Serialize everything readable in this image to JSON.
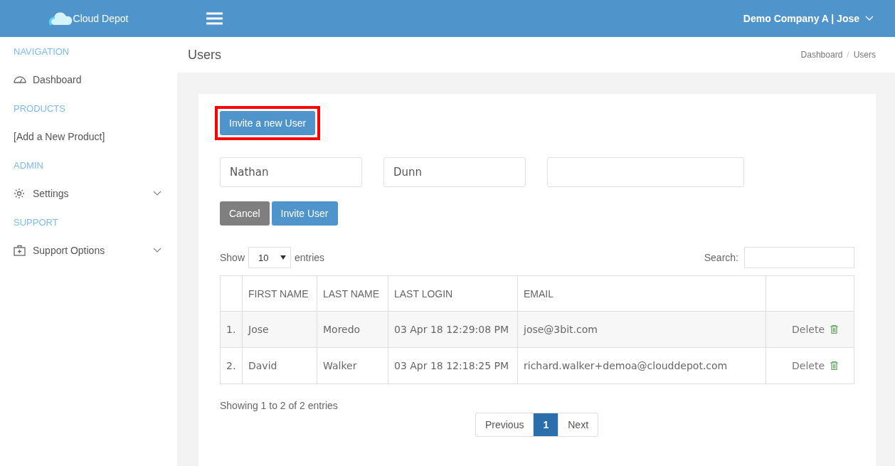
{
  "header": {
    "brand": "Cloud Depot",
    "account": "Demo Company A | Jose"
  },
  "sidebar": {
    "items": [
      {
        "kind": "section",
        "label": "NAVIGATION"
      },
      {
        "kind": "link",
        "label": "Dashboard",
        "expandable": false
      },
      {
        "kind": "section",
        "label": "PRODUCTS"
      },
      {
        "kind": "link",
        "label": "[Add a New Product]",
        "expandable": false
      },
      {
        "kind": "section",
        "label": "ADMIN"
      },
      {
        "kind": "link",
        "label": "Settings",
        "expandable": true
      },
      {
        "kind": "section",
        "label": "SUPPORT"
      },
      {
        "kind": "link",
        "label": "Support Options",
        "expandable": true
      }
    ]
  },
  "page": {
    "title": "Users",
    "breadcrumb": [
      "Dashboard",
      "Users"
    ],
    "breadcrumb_separator": "/"
  },
  "invite": {
    "button": "Invite a new User",
    "highlighted": true,
    "fields": [
      {
        "kind": "name",
        "value": "Nathan"
      },
      {
        "kind": "name",
        "value": "Dunn"
      },
      {
        "kind": "email"
      }
    ],
    "cancel": "Cancel",
    "submit": "Invite User"
  },
  "table_controls": {
    "show": "Show",
    "page_size": "10",
    "entries": "entries",
    "search_label": "Search:"
  },
  "table": {
    "columns": [
      "",
      "FIRST NAME",
      "LAST NAME",
      "LAST LOGIN",
      "EMAIL",
      ""
    ],
    "rows": [
      {
        "index": "1.",
        "first": "Jose",
        "last": "Moredo",
        "login": "03 Apr 18 12:29:08 PM",
        "email": "jose@3bit.com",
        "action": "Delete"
      },
      {
        "index": "2.",
        "first": "David",
        "last": "Walker",
        "login": "03 Apr 18 12:18:25 PM",
        "email": "richard.walker+demoa@clouddepot.com",
        "action": "Delete"
      }
    ]
  },
  "footer": {
    "info": "Showing 1 to 2 of 2 entries",
    "previous": "Previous",
    "pages": [
      {
        "label": "1",
        "selected": true
      }
    ],
    "next": "Next"
  }
}
